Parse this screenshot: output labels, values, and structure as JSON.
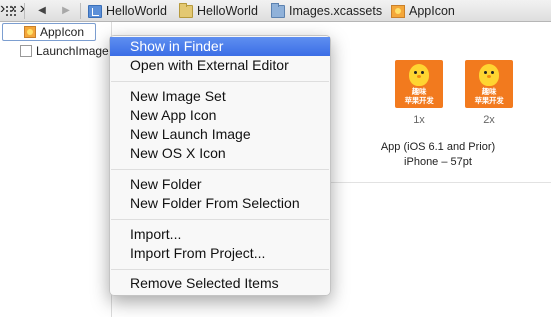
{
  "jumpbar": {
    "breadcrumbs": [
      {
        "label": "HelloWorld",
        "icon": "project-icon"
      },
      {
        "label": "HelloWorld",
        "icon": "folder-icon"
      },
      {
        "label": "Images.xcassets",
        "icon": "asset-catalog-icon"
      },
      {
        "label": "AppIcon",
        "icon": "appicon-icon"
      }
    ]
  },
  "sidebar": {
    "items": [
      {
        "label": "AppIcon",
        "selected": true
      },
      {
        "label": "LaunchImage",
        "selected": false
      }
    ]
  },
  "main": {
    "icon_text_line1": "趣味",
    "icon_text_line2": "苹果开发",
    "scales": [
      "1x",
      "2x"
    ],
    "slot_caption_line1": "App (iOS 6.1 and Prior)",
    "slot_caption_line2": "iPhone – 57pt"
  },
  "context_menu": {
    "groups": [
      [
        "Show in Finder",
        "Open with External Editor"
      ],
      [
        "New Image Set",
        "New App Icon",
        "New Launch Image",
        "New OS X Icon"
      ],
      [
        "New Folder",
        "New Folder From Selection"
      ],
      [
        "Import...",
        "Import From Project..."
      ],
      [
        "Remove Selected Items"
      ]
    ],
    "highlighted": "Show in Finder"
  },
  "colors": {
    "menu_highlight": "#3b6ee6",
    "icon_background": "#f27a1e",
    "selection_border": "#7c9ed0"
  }
}
